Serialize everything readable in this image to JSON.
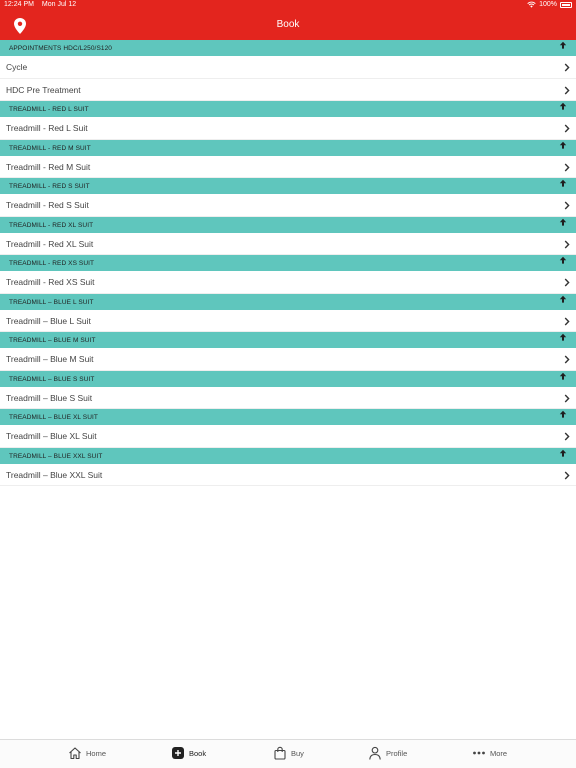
{
  "status_bar": {
    "time": "12:24 PM",
    "date": "Mon Jul 12",
    "battery": "100%"
  },
  "nav": {
    "title": "Book",
    "location_icon": "location-pin-icon"
  },
  "sections": [
    {
      "header": "APPOINTMENTS HDC/L250/S120",
      "items": [
        "Cycle",
        "HDC Pre Treatment"
      ]
    },
    {
      "header": "TREADMILL - RED L SUIT",
      "items": [
        "Treadmill - Red L Suit"
      ]
    },
    {
      "header": "TREADMILL - RED M SUIT",
      "items": [
        "Treadmill - Red M Suit"
      ]
    },
    {
      "header": "TREADMILL - RED S SUIT",
      "items": [
        "Treadmill - Red S Suit"
      ]
    },
    {
      "header": "TREADMILL - RED XL SUIT",
      "items": [
        "Treadmill - Red XL Suit"
      ]
    },
    {
      "header": "TREADMILL - RED XS SUIT",
      "items": [
        "Treadmill - Red XS Suit"
      ]
    },
    {
      "header": "TREADMILL – BLUE L SUIT",
      "items": [
        "Treadmill – Blue L Suit"
      ]
    },
    {
      "header": "TREADMILL – BLUE M SUIT",
      "items": [
        "Treadmill – Blue M Suit"
      ]
    },
    {
      "header": "TREADMILL – BLUE S SUIT",
      "items": [
        "Treadmill – Blue S Suit"
      ]
    },
    {
      "header": "TREADMILL – BLUE XL SUIT",
      "items": [
        "Treadmill – Blue XL Suit"
      ]
    },
    {
      "header": "TREADMILL – BLUE XXL SUIT",
      "items": [
        "Treadmill – Blue XXL Suit"
      ]
    }
  ],
  "tabs": [
    {
      "label": "Home",
      "icon": "home-icon"
    },
    {
      "label": "Book",
      "icon": "plus-square-icon"
    },
    {
      "label": "Buy",
      "icon": "shopping-bag-icon"
    },
    {
      "label": "Profile",
      "icon": "person-icon"
    },
    {
      "label": "More",
      "icon": "ellipsis-icon"
    }
  ],
  "colors": {
    "brand_red": "#e3251e",
    "section_teal": "#5fc6bd"
  }
}
